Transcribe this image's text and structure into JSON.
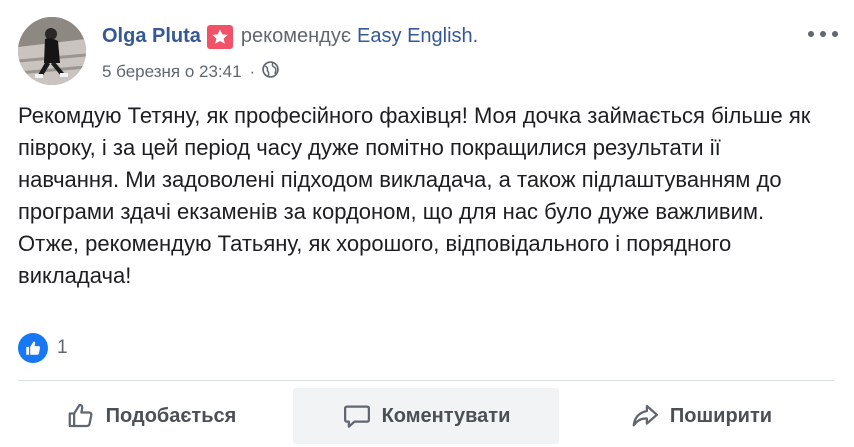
{
  "post": {
    "author": "Olga Pluta",
    "action": "рекомендує",
    "page": "Easy English.",
    "date": "5 березня о 23:41",
    "separator": "·",
    "privacy_icon": "globe-icon",
    "text": "Рекомдую Тетяну, як професійного фахівця! Моя дочка займається більше як півроку, і за цей період часу дуже помітно покращилися результати ії навчання. Ми задоволені підходом викладача, а також підлаштуванням до програми здачі екзаменів за кордоном, що для нас було дуже важливим. Отже, рекомендую Татьяну, як хорошого, відповідального і порядного викладача!"
  },
  "reactions": {
    "icon": "like-icon",
    "count": "1"
  },
  "actions": {
    "like_label": "Подобається",
    "comment_label": "Коментувати",
    "share_label": "Поширити"
  },
  "colors": {
    "link": "#365899",
    "badge": "#f25268",
    "like_blue": "#1877f2",
    "muted": "#616770"
  }
}
